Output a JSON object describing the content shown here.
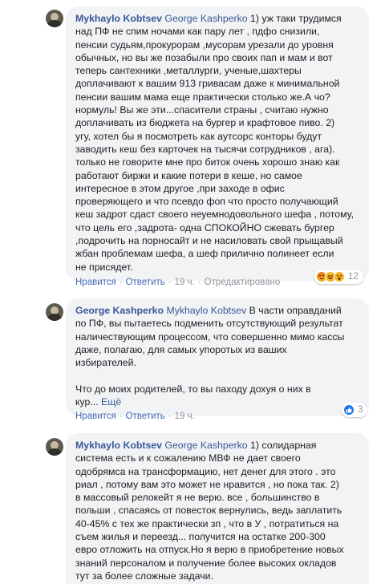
{
  "comments": [
    {
      "author": "Mykhaylo Kobtsev",
      "mention": "George Kashperko",
      "text": " 1) уж таки трудимся\nнад ПФ не спим ночами как пару лет , пдфо снизили,\nпенсии судьям,прокурорам ,мусорам урезали до уровня\nобычных, но вы же позабыли про своих пап и мам и вот\nтеперь сантехники ,металлурги, ученые,шахтеры\nдоплачивают к вашим 913 гривасам даже к минимальной\nпенсии вашим мама еще практически столько же.А чо?\nнормуль! Вы же эти...спасители страны , считаю нужно\nдоплачивать из бюджета на бургер и крафтовое пиво. 2)\nугу, хотел бы я посмотреть как аутсорс конторы будут\nзаводить кеш без карточек на тысячи сотрудников , ага).\nтолько не говорите мне про биток очень хорошо знаю как\nработают биржи и какие потери в кеше, но самое\nинтересное в этом другое ,при заходе в офис\nпроверяющего и что псевдо фоп что просто получающий\nкеш задрот сдаст своего неуемнодовольного шефа , потому,\nчто цель его ,задрота- одна СПОКОЙНО сжевать бургер\n,подрочить на порносайт и не насиловать свой прыщавый\nжбан проблемам шефа, а шеф прилично полинеет если\nне присядет.",
      "actions": {
        "like": "Нравится",
        "reply": "Ответить",
        "time": "19 ч.",
        "edited": "Отредактировано"
      },
      "reactions": {
        "icons": [
          "angry-icon",
          "haha-icon",
          "wow-icon"
        ],
        "count": "12"
      }
    },
    {
      "author": "George Kashperko",
      "mention": "Mykhaylo Kobtsev",
      "text": " В части оправданий\nпо ПФ, вы пытаетесь подменить отсутствующий результат\nналичествующим процессом, что совершенно мимо кассы\nдаже, полагаю, для самых упоротых из ваших\nизбирателей.\n\nЧто до моих родителей, то вы паходу дохуя о них в\nкур... ",
      "more": "Ещё",
      "actions": {
        "like": "Нравится",
        "reply": "Ответить",
        "time": "19 ч."
      },
      "reactions": {
        "icons": [
          "like-icon"
        ],
        "count": "3"
      }
    },
    {
      "author": "Mykhaylo Kobtsev",
      "mention": "George Kashperko",
      "text": " 1) солидарная\nсистема есть и к сожалению МВФ не дает своего\nодобрямса на трансформацию, нет денег для этого . это\nриал , потому вам это может не нравится , но пока так. 2)\nв массовый релокейт я не верю. все , большинство в\nпольши , спасаясь от повесток вернулись, ведь заплатить\n40-45% с тех же практически зп , что в У , потратиться на\nсъем жилья и переезд... получится на остатке 200-300\nевро отложить на отпуск.Но я верю в приобретение новых\nзнаний персоналом и получение более высоких окладов\nтут за более сложные задачи."
    }
  ],
  "colors": {
    "link": "#385898",
    "action": "#4267b2",
    "bubble": "#f2f3f5",
    "muted": "#90949c"
  }
}
